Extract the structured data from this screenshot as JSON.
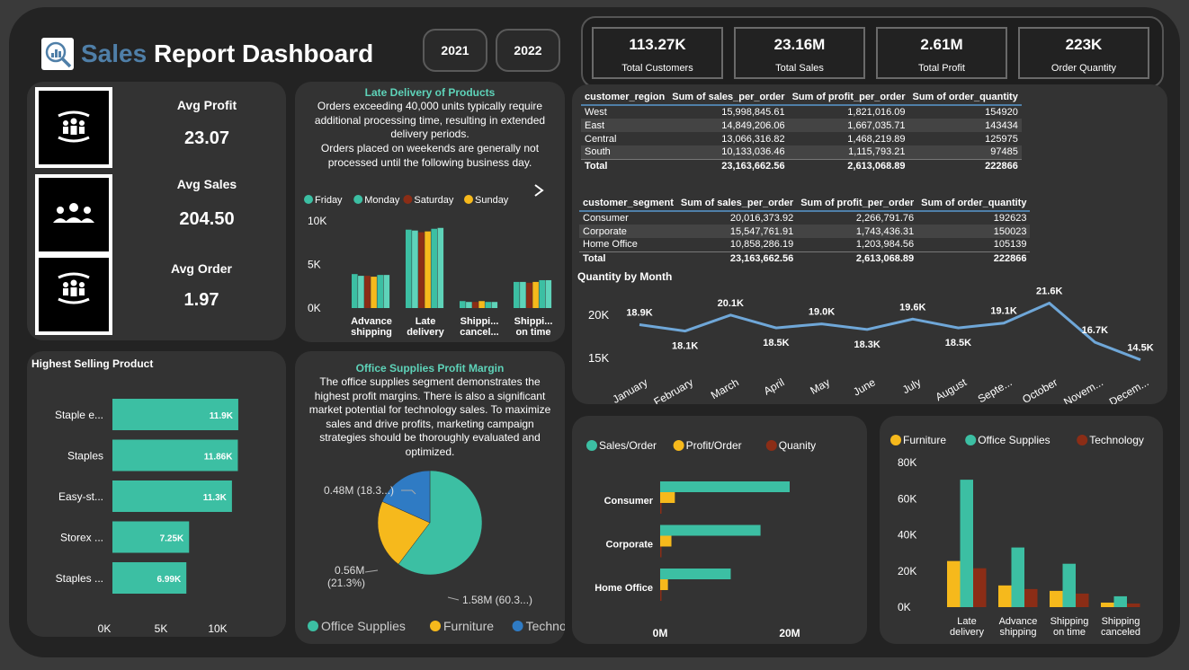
{
  "header": {
    "title_a": "Sales",
    "title_b": "Report Dashboard",
    "years": [
      "2021",
      "2022"
    ]
  },
  "kpis": [
    {
      "value": "113.27K",
      "label": "Total Customers"
    },
    {
      "value": "23.16M",
      "label": "Total Sales"
    },
    {
      "value": "2.61M",
      "label": "Total Profit"
    },
    {
      "value": "223K",
      "label": "Order Quantity"
    }
  ],
  "avgs": {
    "profit_label": "Avg Profit",
    "profit_value": "23.07",
    "sales_label": "Avg Sales",
    "sales_value": "204.50",
    "order_label": "Avg Order",
    "order_value": "1.97"
  },
  "late_delivery": {
    "title": "Late Delivery of Products",
    "text1": "Orders exceeding 40,000 units typically require additional processing time, resulting in extended delivery periods.",
    "text2": "Orders placed on weekends are generally not processed until the following business day."
  },
  "office_supplies": {
    "title": "Office Supplies Profit Margin",
    "text": "The office supplies segment demonstrates the highest profit margins. There is also a significant market potential for technology sales. To maximize sales and drive profits, marketing campaign strategies should be thoroughly evaluated and optimized."
  },
  "region_table": {
    "headers": [
      "customer_region",
      "Sum of sales_per_order",
      "Sum of profit_per_order",
      "Sum of order_quantity"
    ],
    "rows": [
      [
        "West",
        "15,998,845.61",
        "1,821,016.09",
        "154920"
      ],
      [
        "East",
        "14,849,206.06",
        "1,667,035.71",
        "143434"
      ],
      [
        "Central",
        "13,066,316.82",
        "1,468,219.89",
        "125975"
      ],
      [
        "South",
        "10,133,036.46",
        "1,115,793.21",
        "97485"
      ]
    ],
    "total": [
      "Total",
      "23,163,662.56",
      "2,613,068.89",
      "222866"
    ]
  },
  "segment_table": {
    "headers": [
      "customer_segment",
      "Sum of sales_per_order",
      "Sum of profit_per_order",
      "Sum of order_quantity"
    ],
    "rows": [
      [
        "Consumer",
        "20,016,373.92",
        "2,266,791.76",
        "192623"
      ],
      [
        "Corporate",
        "15,547,761.91",
        "1,743,436.31",
        "150023"
      ],
      [
        "Home Office",
        "10,858,286.19",
        "1,203,984.56",
        "105139"
      ]
    ],
    "total": [
      "Total",
      "23,163,662.56",
      "2,613,068.89",
      "222866"
    ]
  },
  "colors": {
    "teal": "#5ed3b9",
    "yellow": "#f6b91c",
    "brown": "#8b2d16",
    "blue": "#2f7bc4",
    "bar_teal": "#3cbfa3",
    "line": "#6fa7d8"
  },
  "chart_data": [
    {
      "id": "late_delivery",
      "type": "bar",
      "categories": [
        "Advance shipping",
        "Late delivery",
        "Shippi... cancel...",
        "Shippi... on time"
      ],
      "series": [
        {
          "name": "Friday",
          "values": [
            3900,
            9000,
            800,
            3000
          ]
        },
        {
          "name": "Monday",
          "values": [
            3700,
            8900,
            700,
            3000
          ]
        },
        {
          "name": "Saturday",
          "values": [
            3700,
            8700,
            700,
            2900
          ]
        },
        {
          "name": "Sunday",
          "values": [
            3600,
            8800,
            800,
            3000
          ]
        },
        {
          "name": "",
          "values": [
            3800,
            9100,
            700,
            3200
          ]
        },
        {
          "name": "",
          "values": [
            3800,
            9200,
            700,
            3200
          ]
        }
      ],
      "ylim": [
        0,
        10000
      ],
      "yticks": [
        "10K",
        "5K",
        "0K"
      ]
    },
    {
      "id": "highest_selling",
      "type": "bar",
      "title": "Highest Selling Product",
      "categories": [
        "Staple e...",
        "Staples",
        "Easy-st...",
        "Storex ...",
        "Staples ..."
      ],
      "values": [
        11900,
        11860,
        11300,
        7250,
        6990
      ],
      "labels": [
        "11.9K",
        "11.86K",
        "11.3K",
        "7.25K",
        "6.99K"
      ],
      "xticks": [
        "0K",
        "5K",
        "10K"
      ],
      "xlim": [
        0,
        12000
      ]
    },
    {
      "id": "office_pie",
      "type": "pie",
      "slices": [
        {
          "name": "Office Supplies",
          "value": 1.58,
          "label": "1.58M (60.3...)"
        },
        {
          "name": "Furniture",
          "value": 0.56,
          "label": "0.56M (21.3%)"
        },
        {
          "name": "Technology",
          "value": 0.48,
          "label": "0.48M (18.3...)"
        }
      ]
    },
    {
      "id": "quantity_month",
      "type": "line",
      "title": "Quantity by Month",
      "x": [
        "January",
        "February",
        "March",
        "April",
        "May",
        "June",
        "July",
        "August",
        "Septe...",
        "October",
        "Novem...",
        "Decem..."
      ],
      "y": [
        18900,
        18100,
        20100,
        18500,
        19000,
        18300,
        19600,
        18500,
        19100,
        21600,
        16700,
        14500
      ],
      "labels": [
        "18.9K",
        "18.1K",
        "20.1K",
        "18.5K",
        "19.0K",
        "18.3K",
        "19.6K",
        "18.5K",
        "19.1K",
        "21.6K",
        "16.7K",
        "14.5K"
      ],
      "yticks": [
        "20K",
        "15K"
      ]
    },
    {
      "id": "segment_bars",
      "type": "bar",
      "categories": [
        "Consumer",
        "Corporate",
        "Home Office"
      ],
      "series": [
        {
          "name": "Sales/Order",
          "values": [
            20.0,
            15.5,
            10.9
          ]
        },
        {
          "name": "Profit/Order",
          "values": [
            2.27,
            1.74,
            1.2
          ]
        },
        {
          "name": "Quanity",
          "values": [
            0.19,
            0.15,
            0.11
          ]
        }
      ],
      "xticks": [
        "0M",
        "20M"
      ],
      "xlim": [
        0,
        20
      ]
    },
    {
      "id": "category_delivery",
      "type": "bar",
      "categories": [
        "Late delivery",
        "Advance shipping",
        "Shipping on time",
        "Shipping canceled"
      ],
      "series": [
        {
          "name": "Furniture",
          "values": [
            25500,
            12000,
            9000,
            2500
          ]
        },
        {
          "name": "Office Supplies",
          "values": [
            70500,
            33000,
            24000,
            6000
          ]
        },
        {
          "name": "Technology",
          "values": [
            21500,
            10000,
            7500,
            2000
          ]
        }
      ],
      "yticks": [
        "80K",
        "60K",
        "40K",
        "20K",
        "0K"
      ],
      "ylim": [
        0,
        80000
      ]
    }
  ]
}
